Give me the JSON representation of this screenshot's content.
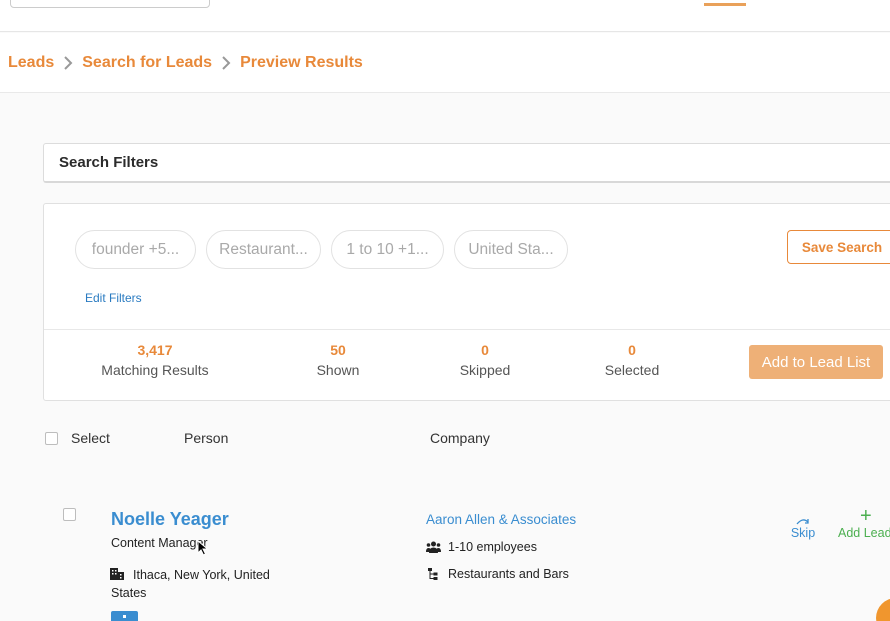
{
  "breadcrumb": {
    "items": [
      "Leads",
      "Search for Leads",
      "Preview Results"
    ]
  },
  "filters": {
    "header": "Search Filters",
    "chips": [
      "founder +5...",
      "Restaurant...",
      "1 to 10 +1...",
      "United Sta..."
    ],
    "edit_label": "Edit Filters",
    "save_label": "Save Search"
  },
  "stats": {
    "matching": {
      "value": "3,417",
      "label": "Matching Results"
    },
    "shown": {
      "value": "50",
      "label": "Shown"
    },
    "skipped": {
      "value": "0",
      "label": "Skipped"
    },
    "selected": {
      "value": "0",
      "label": "Selected"
    },
    "add_label": "Add to Lead List"
  },
  "table": {
    "columns": {
      "select": "Select",
      "person": "Person",
      "company": "Company"
    },
    "rows": [
      {
        "person_name": "Noelle Yeager",
        "person_title": "Content Manager",
        "location": "Ithaca, New York, United States",
        "company_name": "Aaron Allen & Associates",
        "employees": "1-10 employees",
        "industry": "Restaurants and Bars",
        "skip_label": "Skip",
        "add_label": "Add Lead"
      }
    ]
  },
  "colors": {
    "accent": "#e8893a",
    "link": "#3a8dd0",
    "add_green": "#4caf50",
    "button_fill": "#eeb077"
  },
  "icons": [
    "chevron-right-icon",
    "building-icon",
    "users-icon",
    "hierarchy-icon",
    "skip-arrow-icon",
    "plus-icon",
    "linkedin-icon"
  ]
}
